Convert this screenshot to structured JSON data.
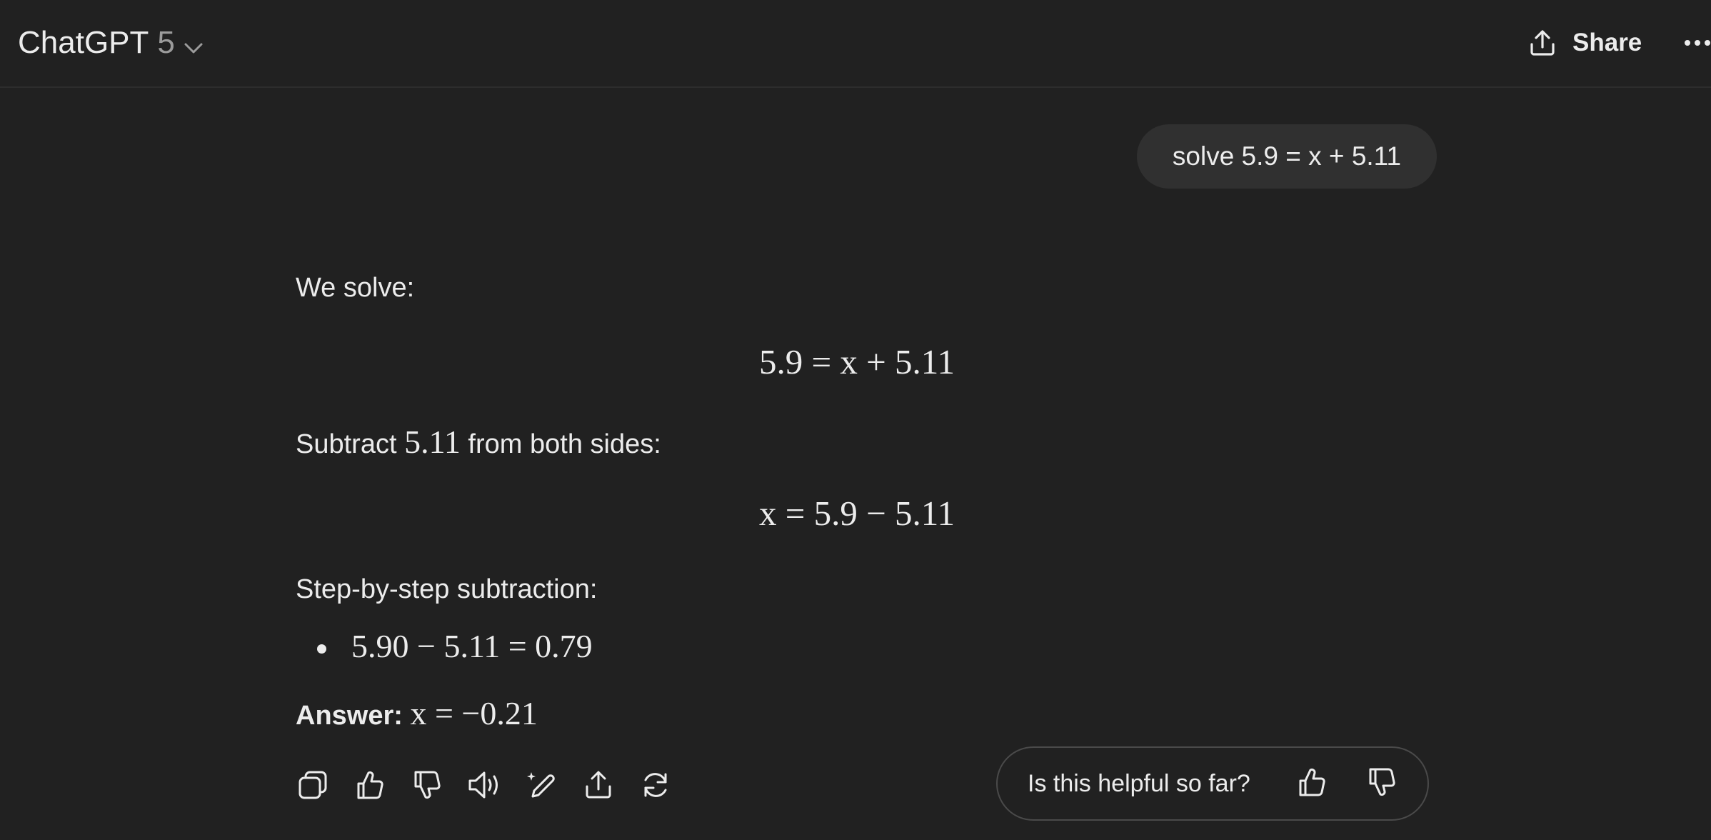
{
  "header": {
    "model_name": "ChatGPT",
    "model_version": "5",
    "share_label": "Share"
  },
  "conversation": {
    "user_message": "solve 5.9 = x + 5.11",
    "assistant": {
      "intro": "We solve:",
      "equation1": "5.9 = x + 5.11",
      "subtract_prefix": "Subtract ",
      "subtract_value": "5.11",
      "subtract_suffix": " from both sides:",
      "equation2": "x = 5.9 − 5.11",
      "steps_heading": "Step-by-step subtraction:",
      "step1": "5.90 − 5.11 = 0.79",
      "answer_label": "Answer:",
      "answer_value": "x = −0.21"
    }
  },
  "feedback": {
    "prompt": "Is this helpful so far?"
  },
  "icons": {
    "copy": "copy-icon",
    "thumbs_up": "thumbs-up-icon",
    "thumbs_down": "thumbs-down-icon",
    "read_aloud": "speaker-icon",
    "edit": "edit-sparkle-icon",
    "share": "share-icon",
    "regenerate": "regenerate-icon"
  },
  "colors": {
    "background": "#212121",
    "bubble": "#303030",
    "text": "#ececec",
    "muted": "#9b9b9b"
  }
}
